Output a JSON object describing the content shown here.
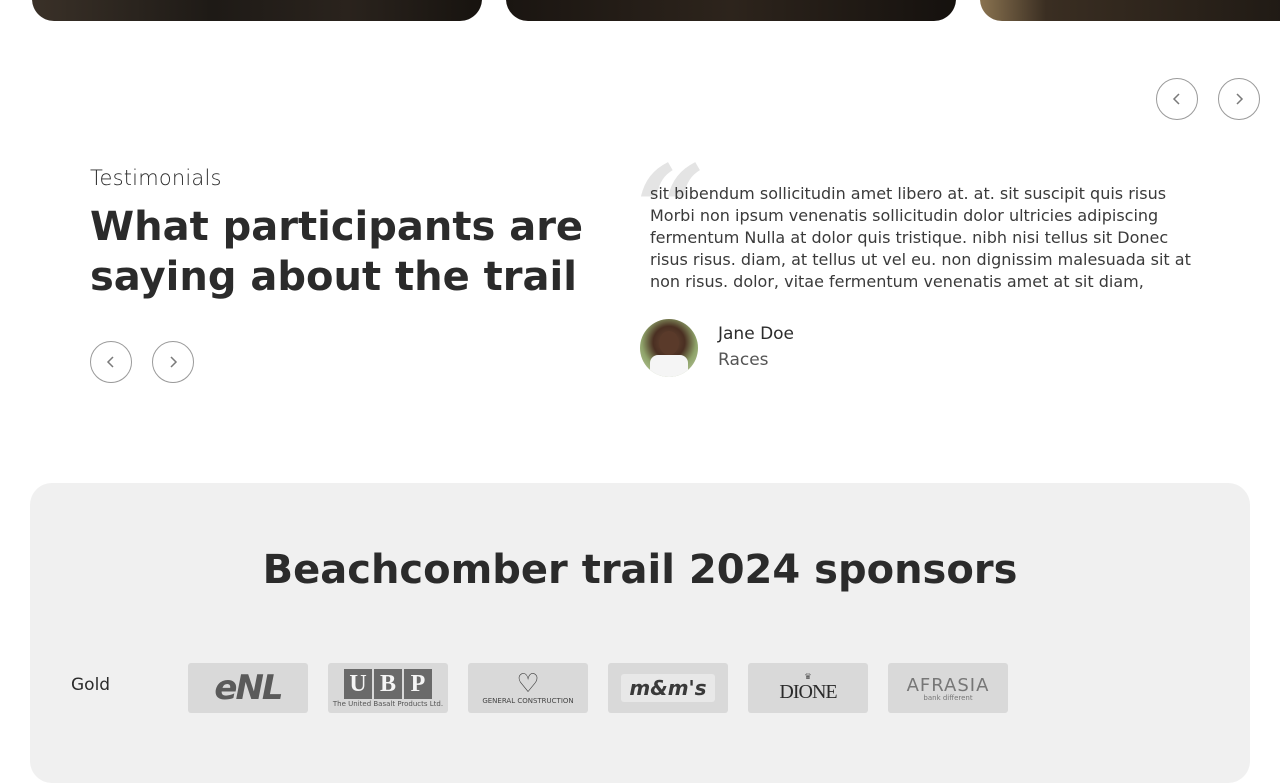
{
  "testimonials": {
    "eyebrow": "Testimonials",
    "headline": "What participants are saying about the trail",
    "quote_mark": "“",
    "quote": "sit bibendum sollicitudin amet libero at. at. sit suscipit quis risus Morbi non ipsum venenatis sollicitudin dolor ultricies adipiscing fermentum Nulla at dolor quis tristique. nibh nisi tellus sit Donec risus risus. diam, at tellus ut vel eu. non dignissim malesuada sit at non risus. dolor, vitae fermentum venenatis amet at sit diam,",
    "person": {
      "name": "Jane Doe",
      "role": "Races"
    }
  },
  "nav_icons": {
    "prev": "chevron-left-icon",
    "next": "chevron-right-icon"
  },
  "sponsors": {
    "title": "Beachcomber trail 2024 sponsors",
    "tiers": [
      {
        "label": "Gold",
        "logos": [
          {
            "name": "ENL",
            "text": "eNL"
          },
          {
            "name": "UBP",
            "letters": [
              "U",
              "B",
              "P"
            ],
            "sub": "The United Basalt Products Ltd."
          },
          {
            "name": "General Construction",
            "text": "GENERAL CONSTRUCTION"
          },
          {
            "name": "M&M's",
            "text": "m&m's"
          },
          {
            "name": "Dione",
            "text": "DIONE"
          },
          {
            "name": "AfrAsia",
            "text": "AFRASIA",
            "sub": "bank different"
          }
        ]
      }
    ]
  },
  "colors": {
    "panel_bg": "#f0f0f0",
    "text": "#2b2b2b",
    "logo_bg": "#d9d9d9"
  }
}
